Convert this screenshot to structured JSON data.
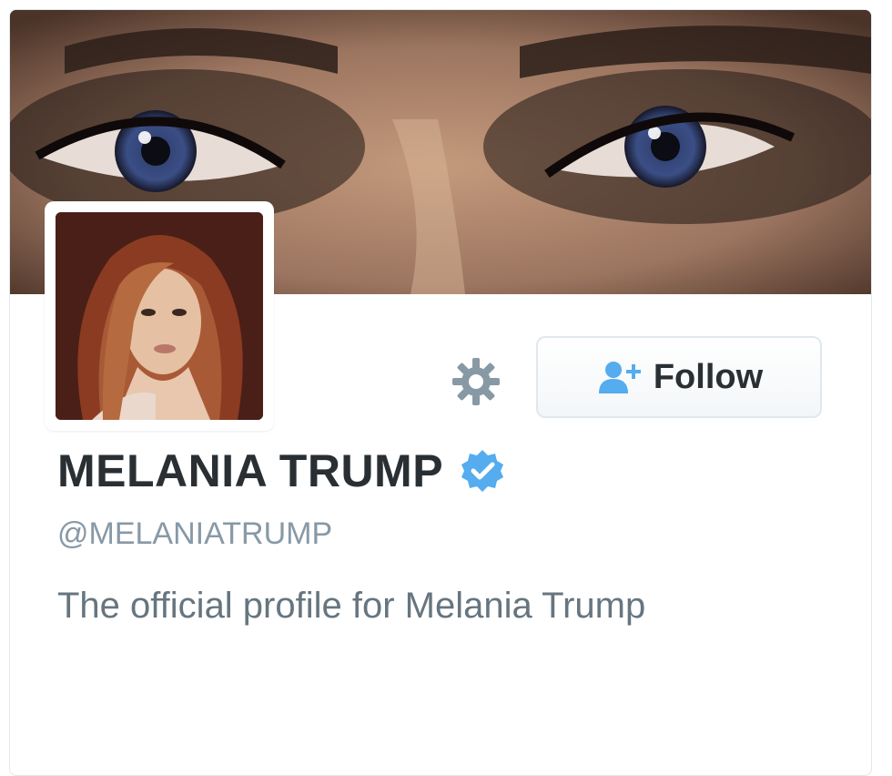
{
  "profile": {
    "name": "MELANIA TRUMP",
    "handle": "@MELANIATRUMP",
    "bio": "The official profile for Melania Trump",
    "verified": true
  },
  "actions": {
    "follow_label": "Follow",
    "settings_icon": "gear-icon",
    "follow_icon": "add-user-icon"
  },
  "colors": {
    "name_text": "#292f33",
    "handle_text": "#8899a6",
    "bio_text": "#66757f",
    "accent_blue": "#55acee",
    "verified_badge": "#55acee",
    "gear": "#8899a6",
    "button_border": "#e1e8ed"
  }
}
